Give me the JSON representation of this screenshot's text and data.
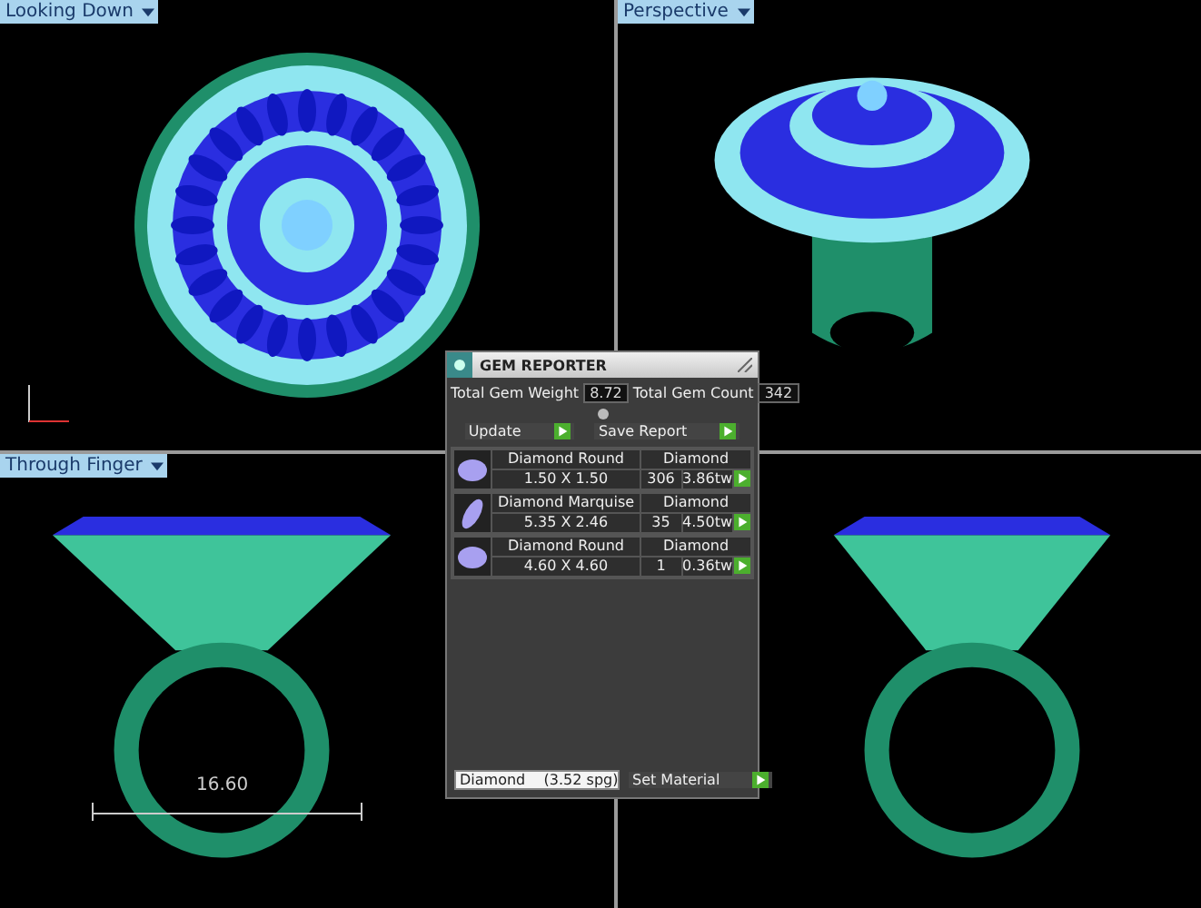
{
  "viewports": [
    {
      "label": "Looking Down"
    },
    {
      "label": "Perspective"
    },
    {
      "label": "Through Finger",
      "dimension": "16.60"
    }
  ],
  "gem_reporter": {
    "title": "GEM REPORTER",
    "total_weight_label": "Total Gem Weight",
    "total_weight": "8.72",
    "total_count_label": "Total Gem Count",
    "total_count": "342",
    "update_button": "Update",
    "save_button": "Save Report",
    "gems": [
      {
        "name": "Diamond Round",
        "size": "1.50 X 1.50",
        "material": "Diamond",
        "count": "306",
        "weight": "3.86tw"
      },
      {
        "name": "Diamond Marquise",
        "size": "5.35 X 2.46",
        "material": "Diamond",
        "count": "35",
        "weight": "4.50tw"
      },
      {
        "name": "Diamond Round",
        "size": "4.60 X 4.60",
        "material": "Diamond",
        "count": "1",
        "weight": "0.36tw"
      }
    ],
    "material_select": "Diamond    (3.52 spg)",
    "set_material_button": "Set Material"
  }
}
